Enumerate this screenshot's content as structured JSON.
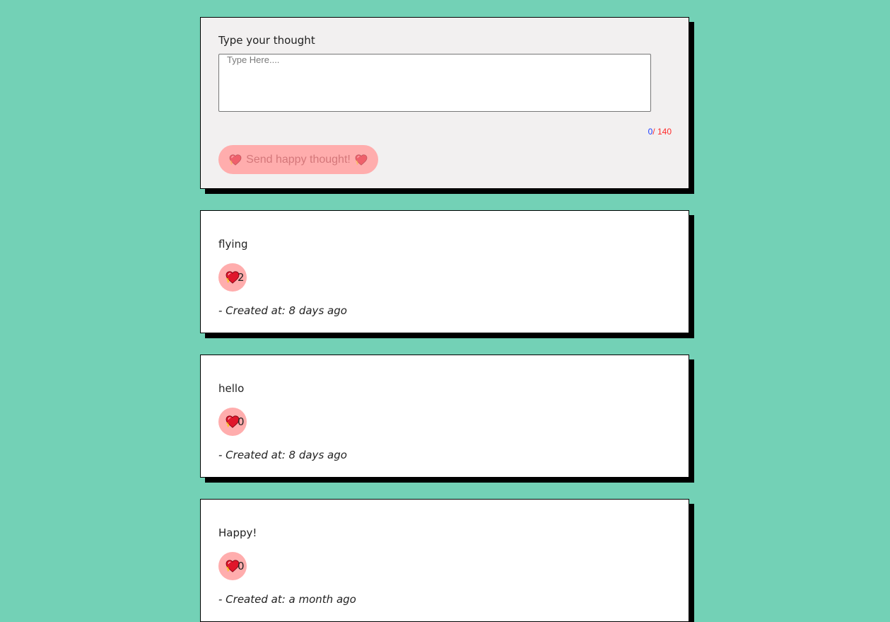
{
  "form": {
    "label": "Type your thought",
    "input_placeholder": "Type Here....",
    "input_value": "",
    "counter_current": "0",
    "counter_max": "/ 140",
    "send_button_label": "Send happy thought!",
    "send_button_icon": "sparkling-heart-icon"
  },
  "thoughts": [
    {
      "text": "flying",
      "likes": "2",
      "created": "- Created at: 8 days ago"
    },
    {
      "text": "hello",
      "likes": "0",
      "created": "- Created at: 8 days ago"
    },
    {
      "text": "Happy!",
      "likes": "0",
      "created": "- Created at: a month ago"
    }
  ],
  "colors": {
    "background": "#73d1b6",
    "form_card": "#f2f0f0",
    "accent_pink": "#ffadad",
    "counter_count": "#1a3cff",
    "counter_max": "#ff2a2a"
  }
}
